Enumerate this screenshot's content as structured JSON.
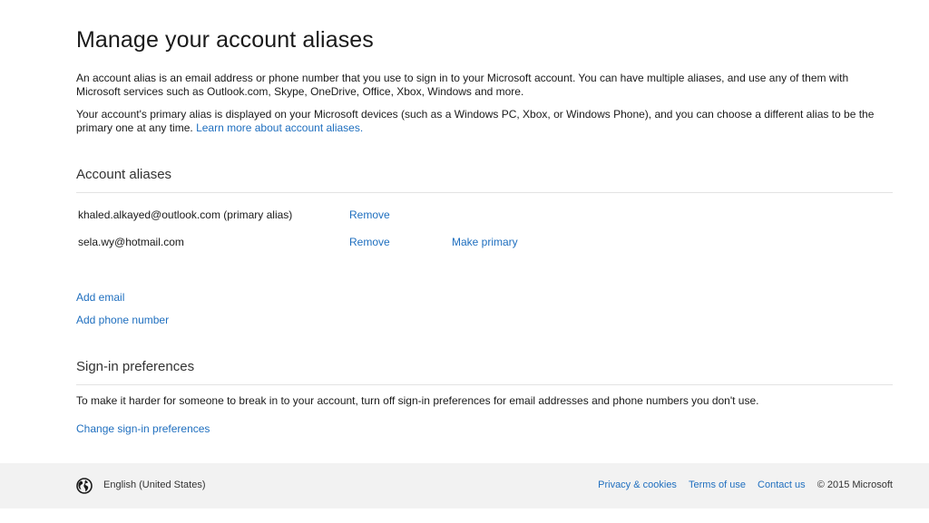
{
  "page": {
    "title": "Manage your account aliases",
    "intro_paragraph": "An account alias is an email address or phone number that you use to sign in to your Microsoft account. You can have multiple aliases, and use any of them with Microsoft services such as Outlook.com, Skype, OneDrive, Office, Xbox, Windows and more.",
    "primary_paragraph": "Your account's primary alias is displayed on your Microsoft devices (such as a Windows PC, Xbox, or Windows Phone), and you can choose a different alias to be the primary one at any time.",
    "learn_more_link": "Learn more about account aliases."
  },
  "aliases_section": {
    "heading": "Account aliases",
    "aliases": [
      {
        "email": "khaled.alkayed@outlook.com (primary alias)",
        "remove_label": "Remove"
      },
      {
        "email": "sela.wy@hotmail.com",
        "remove_label": "Remove",
        "make_primary_label": "Make primary"
      }
    ],
    "add_email_label": "Add email",
    "add_phone_label": "Add phone number"
  },
  "signin_section": {
    "heading": "Sign-in preferences",
    "description": "To make it harder for someone to break in to your account, turn off sign-in preferences for email addresses and phone numbers you don't use.",
    "change_link": "Change sign-in preferences"
  },
  "footer": {
    "globe_icon": "globe-icon",
    "language": "English (United States)",
    "privacy_link": "Privacy & cookies",
    "terms_link": "Terms of use",
    "contact_link": "Contact us",
    "copyright": "© 2015 Microsoft"
  },
  "colors": {
    "link": "#1f6fbf",
    "text": "#1a1a1a",
    "footer_background": "#f2f2f2",
    "divider": "#e3e3e3"
  }
}
